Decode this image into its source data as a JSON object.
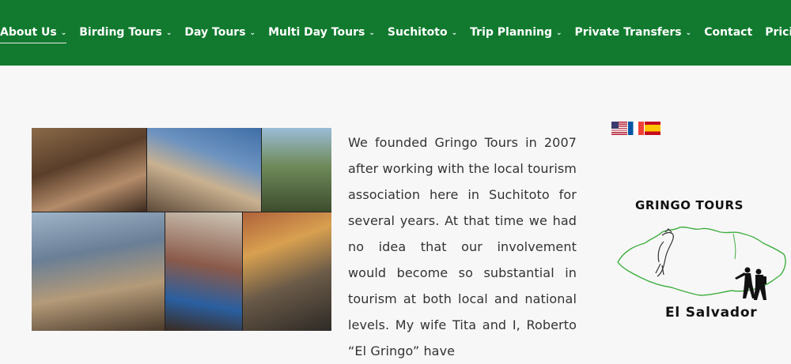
{
  "nav": {
    "items": [
      {
        "label": "About Us",
        "dropdown": true,
        "active": true
      },
      {
        "label": "Birding Tours",
        "dropdown": true
      },
      {
        "label": "Day Tours",
        "dropdown": true
      },
      {
        "label": "Multi Day Tours",
        "dropdown": true
      },
      {
        "label": "Suchitoto",
        "dropdown": true
      },
      {
        "label": "Trip Planning",
        "dropdown": true
      },
      {
        "label": "Private Transfers",
        "dropdown": true
      },
      {
        "label": "Contact",
        "dropdown": false
      },
      {
        "label": "Pricing",
        "dropdown": false
      }
    ],
    "background": "#117a2e"
  },
  "about": {
    "text": "We founded Gringo Tours in 2007 after working with the local tourism association here in Suchitoto for several years. At that time we had no idea that our involvement would become so substantial in tourism at both local and national levels. My wife Tita and I, Roberto “El Gringo” have"
  },
  "languages": [
    "english-flag",
    "french-flag",
    "spanish-flag"
  ],
  "logo": {
    "title": "GRINGO TOURS",
    "subtitle": "El Salvador"
  }
}
